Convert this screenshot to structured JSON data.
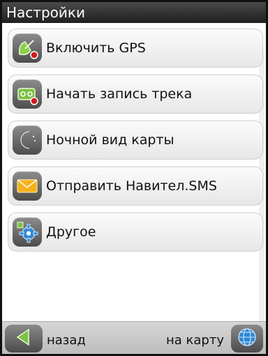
{
  "window": {
    "title": "Настройки"
  },
  "menu": {
    "items": [
      {
        "label": "Включить GPS",
        "icon": "gps-antenna-icon"
      },
      {
        "label": "Начать запись трека",
        "icon": "record-track-icon"
      },
      {
        "label": "Ночной вид карты",
        "icon": "night-mode-icon"
      },
      {
        "label": "Отправить Навител.SMS",
        "icon": "sms-envelope-icon"
      },
      {
        "label": "Другое",
        "icon": "settings-gear-icon"
      }
    ]
  },
  "bottom_bar": {
    "back_label": "назад",
    "map_label": "на карту",
    "back_icon": "back-arrow-icon",
    "map_icon": "globe-icon"
  },
  "colors": {
    "title_bar": "#2a2a2a",
    "accent_green": "#7cc243",
    "accent_orange": "#f39c12",
    "accent_red": "#d01b1b",
    "accent_blue": "#2f88d6"
  }
}
